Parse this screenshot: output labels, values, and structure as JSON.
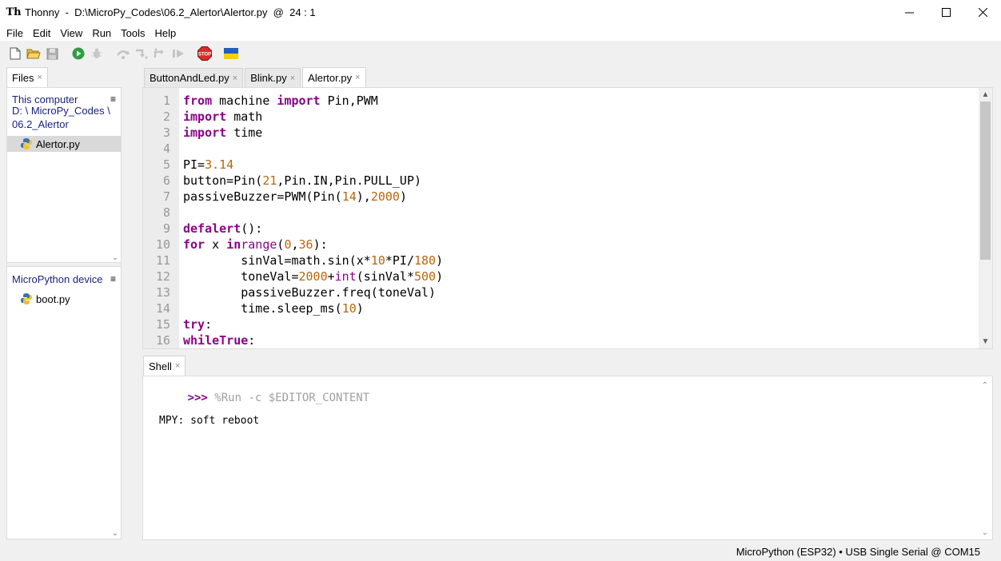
{
  "window": {
    "app_glyph": "Th",
    "title": "Thonny  -  D:\\MicroPy_Codes\\06.2_Alertor\\Alertor.py  @  24 : 1",
    "minimize_icon": "minimize-icon",
    "maximize_icon": "maximize-icon",
    "close_icon": "close-icon"
  },
  "menu": [
    "File",
    "Edit",
    "View",
    "Run",
    "Tools",
    "Help"
  ],
  "toolbar": {
    "buttons": [
      "new-file",
      "open-file",
      "save-file",
      "run",
      "debug",
      "step-over",
      "step-into",
      "step-out",
      "resume",
      "stop",
      "ukraine-flag"
    ],
    "stop_label": "STOP"
  },
  "files": {
    "tab_label": "Files",
    "computer_header": "This computer",
    "path_lines": [
      "D: \\ MicroPy_Codes \\",
      "06.2_Alertor"
    ],
    "computer_files": [
      "Alertor.py"
    ],
    "device_header": "MicroPython device",
    "device_files": [
      "boot.py"
    ],
    "menu_glyph": "≡"
  },
  "editor": {
    "tabs": [
      "ButtonAndLed.py",
      "Blink.py",
      "Alertor.py"
    ],
    "active_tab": 2,
    "line_numbers": [
      "1",
      "2",
      "3",
      "4",
      "5",
      "6",
      "7",
      "8",
      "9",
      "10",
      "11",
      "12",
      "13",
      "14",
      "15",
      "16"
    ],
    "code_lines": [
      "from machine import Pin,PWM",
      "import math",
      "import time",
      "",
      "PI=3.14",
      "button=Pin(21,Pin.IN,Pin.PULL_UP)",
      "passiveBuzzer=PWM(Pin(14),2000)",
      "",
      "def alert():",
      "    for x in range(0,36):",
      "        sinVal=math.sin(x*10*PI/180)",
      "        toneVal=2000+int(sinVal*500)",
      "        passiveBuzzer.freq(toneVal)",
      "        time.sleep_ms(10)",
      "try:",
      "    while True:"
    ]
  },
  "shell": {
    "tab_label": "Shell",
    "prompt": ">>>",
    "command": " %Run -c $EDITOR_CONTENT",
    "output": "MPY: soft reboot"
  },
  "status": {
    "text": "MicroPython (ESP32)  •  USB Single Serial @ COM15"
  },
  "colors": {
    "keyword": "#8b008b",
    "number": "#b8660b",
    "link": "#1a237e"
  }
}
